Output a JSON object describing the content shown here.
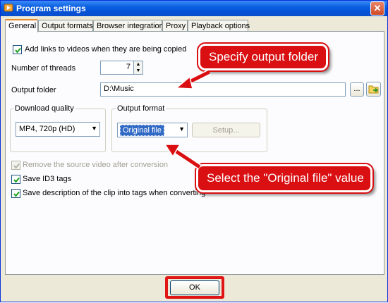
{
  "window": {
    "title": "Program settings",
    "close_label": "✕"
  },
  "tabs": [
    {
      "label": "General",
      "active": true
    },
    {
      "label": "Output formats"
    },
    {
      "label": "Browser integration"
    },
    {
      "label": "Proxy"
    },
    {
      "label": "Playback options"
    }
  ],
  "general": {
    "add_links_label": "Add links to videos when they are being copied",
    "add_links_checked": true,
    "threads_label": "Number of threads",
    "threads_value": "7",
    "output_folder_label": "Output folder",
    "output_folder_value": "D:\\Music",
    "browse_label": "...",
    "download_quality": {
      "group_label": "Download quality",
      "selected": "MP4, 720p (HD)"
    },
    "output_format": {
      "group_label": "Output format",
      "selected": "Original file",
      "setup_label": "Setup..."
    },
    "remove_source_label": "Remove the source video after conversion",
    "remove_source_checked": true,
    "remove_source_disabled": true,
    "save_id3_label": "Save ID3 tags",
    "save_id3_checked": true,
    "save_description_label": "Save description of the clip into tags when converting",
    "save_description_checked": true
  },
  "footer": {
    "ok_label": "OK"
  },
  "annotations": {
    "callout_folder": "Specify output folder",
    "callout_format": "Select the \"Original file\" value",
    "color": "#d90f12"
  }
}
